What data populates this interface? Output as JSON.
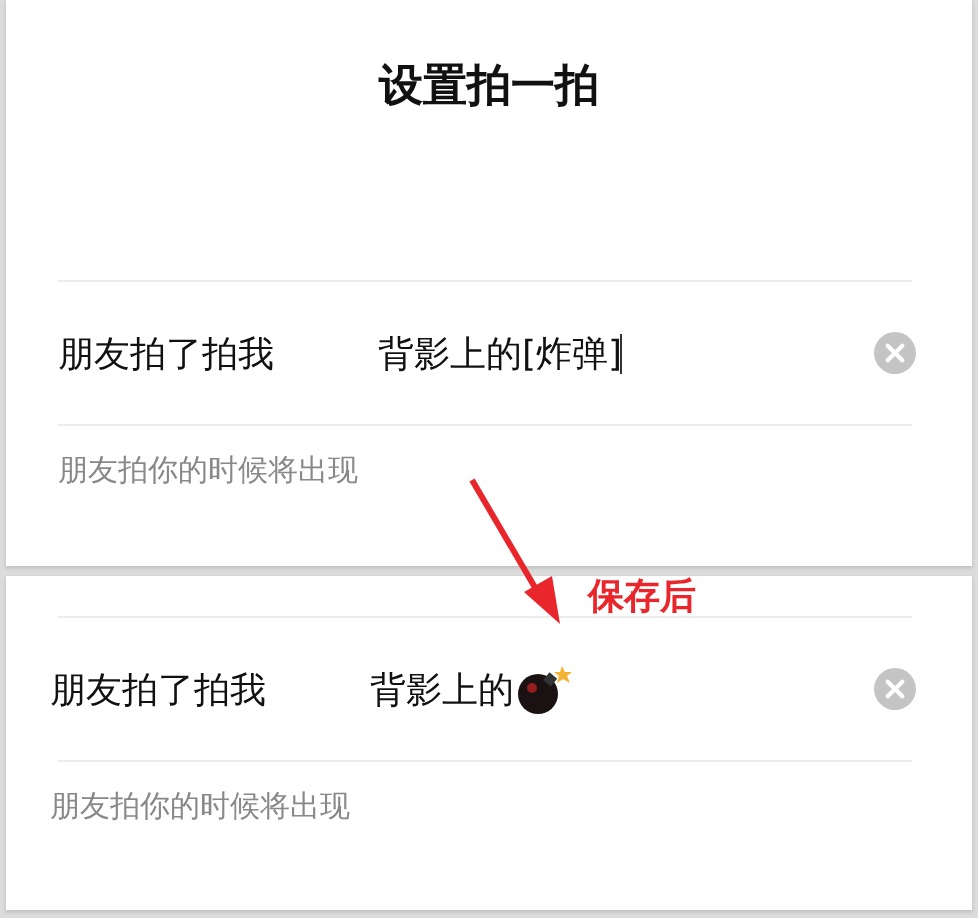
{
  "title": "设置拍一拍",
  "screens": [
    {
      "prefix": "朋友拍了拍我",
      "value": "背影上的[炸弹]",
      "cursor": true,
      "bomb": false,
      "hint": "朋友拍你的时候将出现"
    },
    {
      "prefix": "朋友拍了拍我",
      "value": "背影上的",
      "cursor": false,
      "bomb": true,
      "hint": "朋友拍你的时候将出现"
    }
  ],
  "annotation": {
    "label": "保存后"
  }
}
